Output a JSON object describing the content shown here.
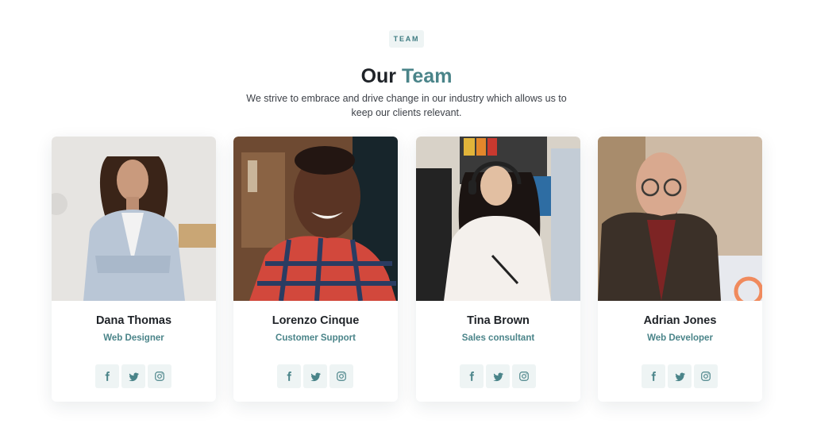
{
  "section": {
    "eyebrow": "TEAM",
    "title_main": "Our",
    "title_accent": "Team",
    "subtitle": "We strive to embrace and drive change in our industry which allows us to keep our clients relevant."
  },
  "colors": {
    "accent": "#4a8489",
    "icon_bg": "#eef4f4",
    "heading": "#1f2328"
  },
  "team": [
    {
      "name": "Dana Thomas",
      "role": "Web Designer",
      "photo": "woman-in-blazer-photo",
      "socials": [
        "facebook-icon",
        "twitter-icon",
        "instagram-icon"
      ]
    },
    {
      "name": "Lorenzo Cinque",
      "role": "Customer Support",
      "photo": "smiling-man-plaid-shirt-photo",
      "socials": [
        "facebook-icon",
        "twitter-icon",
        "instagram-icon"
      ]
    },
    {
      "name": "Tina Brown",
      "role": "Sales consultant",
      "photo": "woman-with-headset-photo",
      "socials": [
        "facebook-icon",
        "twitter-icon",
        "instagram-icon"
      ]
    },
    {
      "name": "Adrian Jones",
      "role": "Web Developer",
      "photo": "man-with-glasses-photo",
      "socials": [
        "facebook-icon",
        "twitter-icon",
        "instagram-icon"
      ]
    }
  ]
}
